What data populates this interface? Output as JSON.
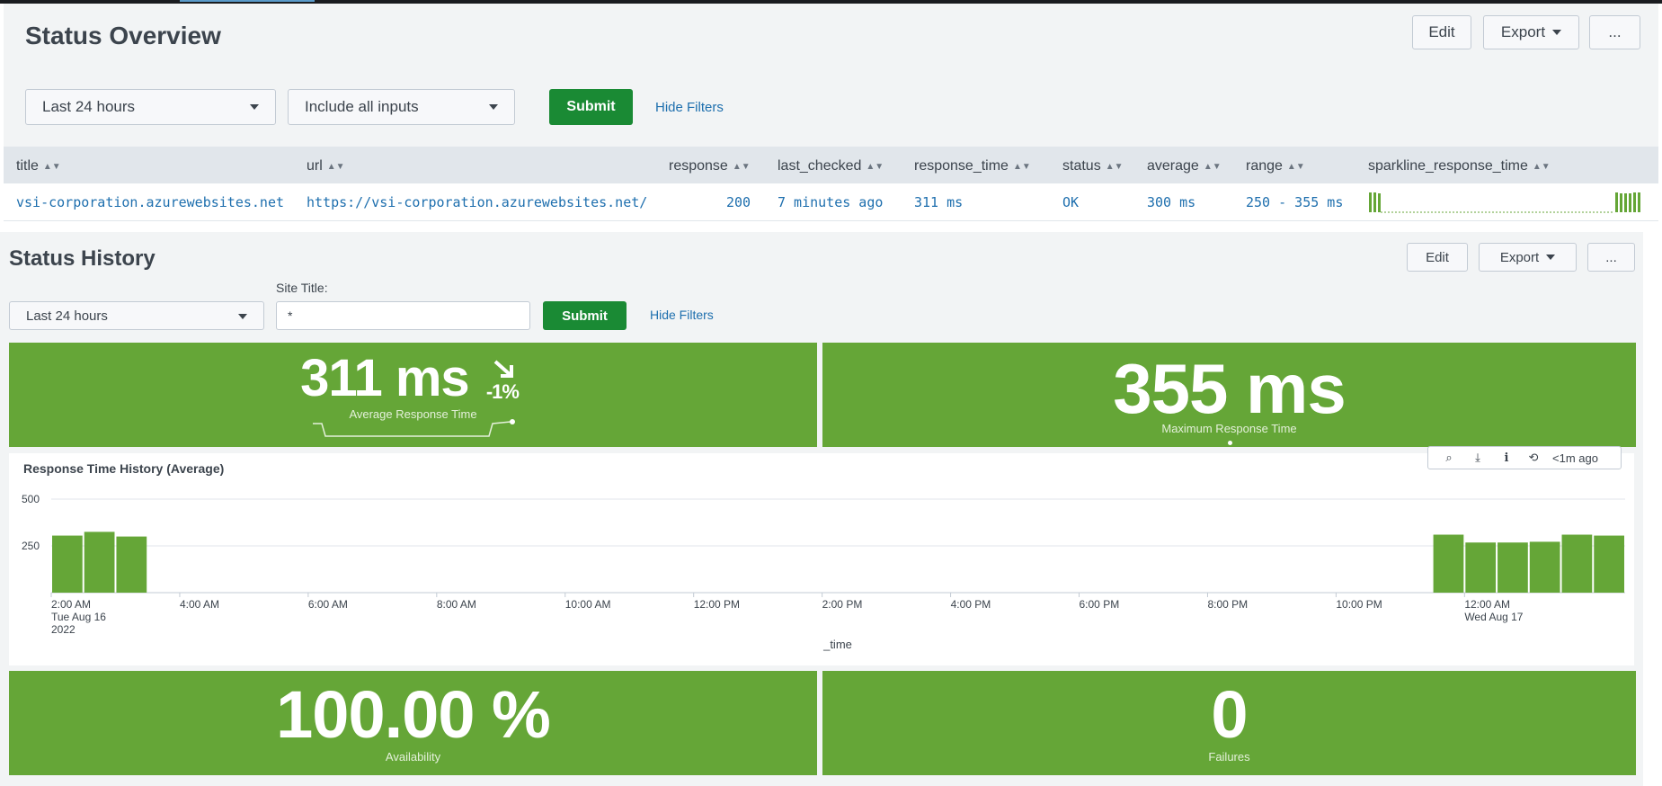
{
  "overview": {
    "title": "Status Overview",
    "edit_label": "Edit",
    "export_label": "Export",
    "more_label": "...",
    "time_select": "Last 24 hours",
    "inputs_select": "Include all inputs",
    "submit_label": "Submit",
    "hide_filters_label": "Hide Filters",
    "columns": [
      "title",
      "url",
      "response",
      "last_checked",
      "response_time",
      "status",
      "average",
      "range",
      "sparkline_response_time"
    ],
    "row": {
      "title": "vsi-corporation.azurewebsites.net",
      "url": "https://vsi-corporation.azurewebsites.net/",
      "response": "200",
      "last_checked": "7 minutes ago",
      "response_time": "311 ms",
      "status": "OK",
      "average": "300 ms",
      "range": "250 - 355 ms"
    }
  },
  "history": {
    "title": "Status History",
    "edit_label": "Edit",
    "export_label": "Export",
    "more_label": "...",
    "time_select": "Last 24 hours",
    "site_title_label": "Site Title:",
    "site_title_value": "*",
    "submit_label": "Submit",
    "hide_filters_label": "Hide Filters"
  },
  "singles": {
    "avg": {
      "value": "311 ms",
      "delta": "-1%",
      "label": "Average Response Time"
    },
    "max": {
      "value": "355 ms",
      "label": "Maximum Response Time"
    },
    "availability": {
      "value": "100.00 %",
      "label": "Availability"
    },
    "failures": {
      "value": "0",
      "label": "Failures"
    }
  },
  "chart_toolbar": {
    "refresh_text": "<1m ago"
  },
  "colors": {
    "green": "#65a637",
    "submit_green": "#1a8a34",
    "link_blue": "#1e6fae"
  },
  "chart_data": {
    "type": "bar",
    "title": "Response Time History (Average)",
    "xlabel": "_time",
    "ylabel": "",
    "ylim": [
      0,
      500
    ],
    "yticks": [
      "250",
      "500"
    ],
    "xticks": [
      {
        "label": "2:00 AM",
        "sub": "Tue Aug 16",
        "sub2": "2022"
      },
      {
        "label": "4:00 AM"
      },
      {
        "label": "6:00 AM"
      },
      {
        "label": "8:00 AM"
      },
      {
        "label": "10:00 AM"
      },
      {
        "label": "12:00 PM"
      },
      {
        "label": "2:00 PM"
      },
      {
        "label": "4:00 PM"
      },
      {
        "label": "6:00 PM"
      },
      {
        "label": "8:00 PM"
      },
      {
        "label": "10:00 PM"
      },
      {
        "label": "12:00 AM",
        "sub": "Wed Aug 17"
      }
    ],
    "bars": [
      {
        "slot": 0,
        "value": 305
      },
      {
        "slot": 1,
        "value": 325
      },
      {
        "slot": 2,
        "value": 300
      },
      {
        "slot": 43,
        "value": 310
      },
      {
        "slot": 44,
        "value": 268
      },
      {
        "slot": 45,
        "value": 268
      },
      {
        "slot": 46,
        "value": 272
      },
      {
        "slot": 47,
        "value": 310
      },
      {
        "slot": 48,
        "value": 305
      }
    ]
  }
}
